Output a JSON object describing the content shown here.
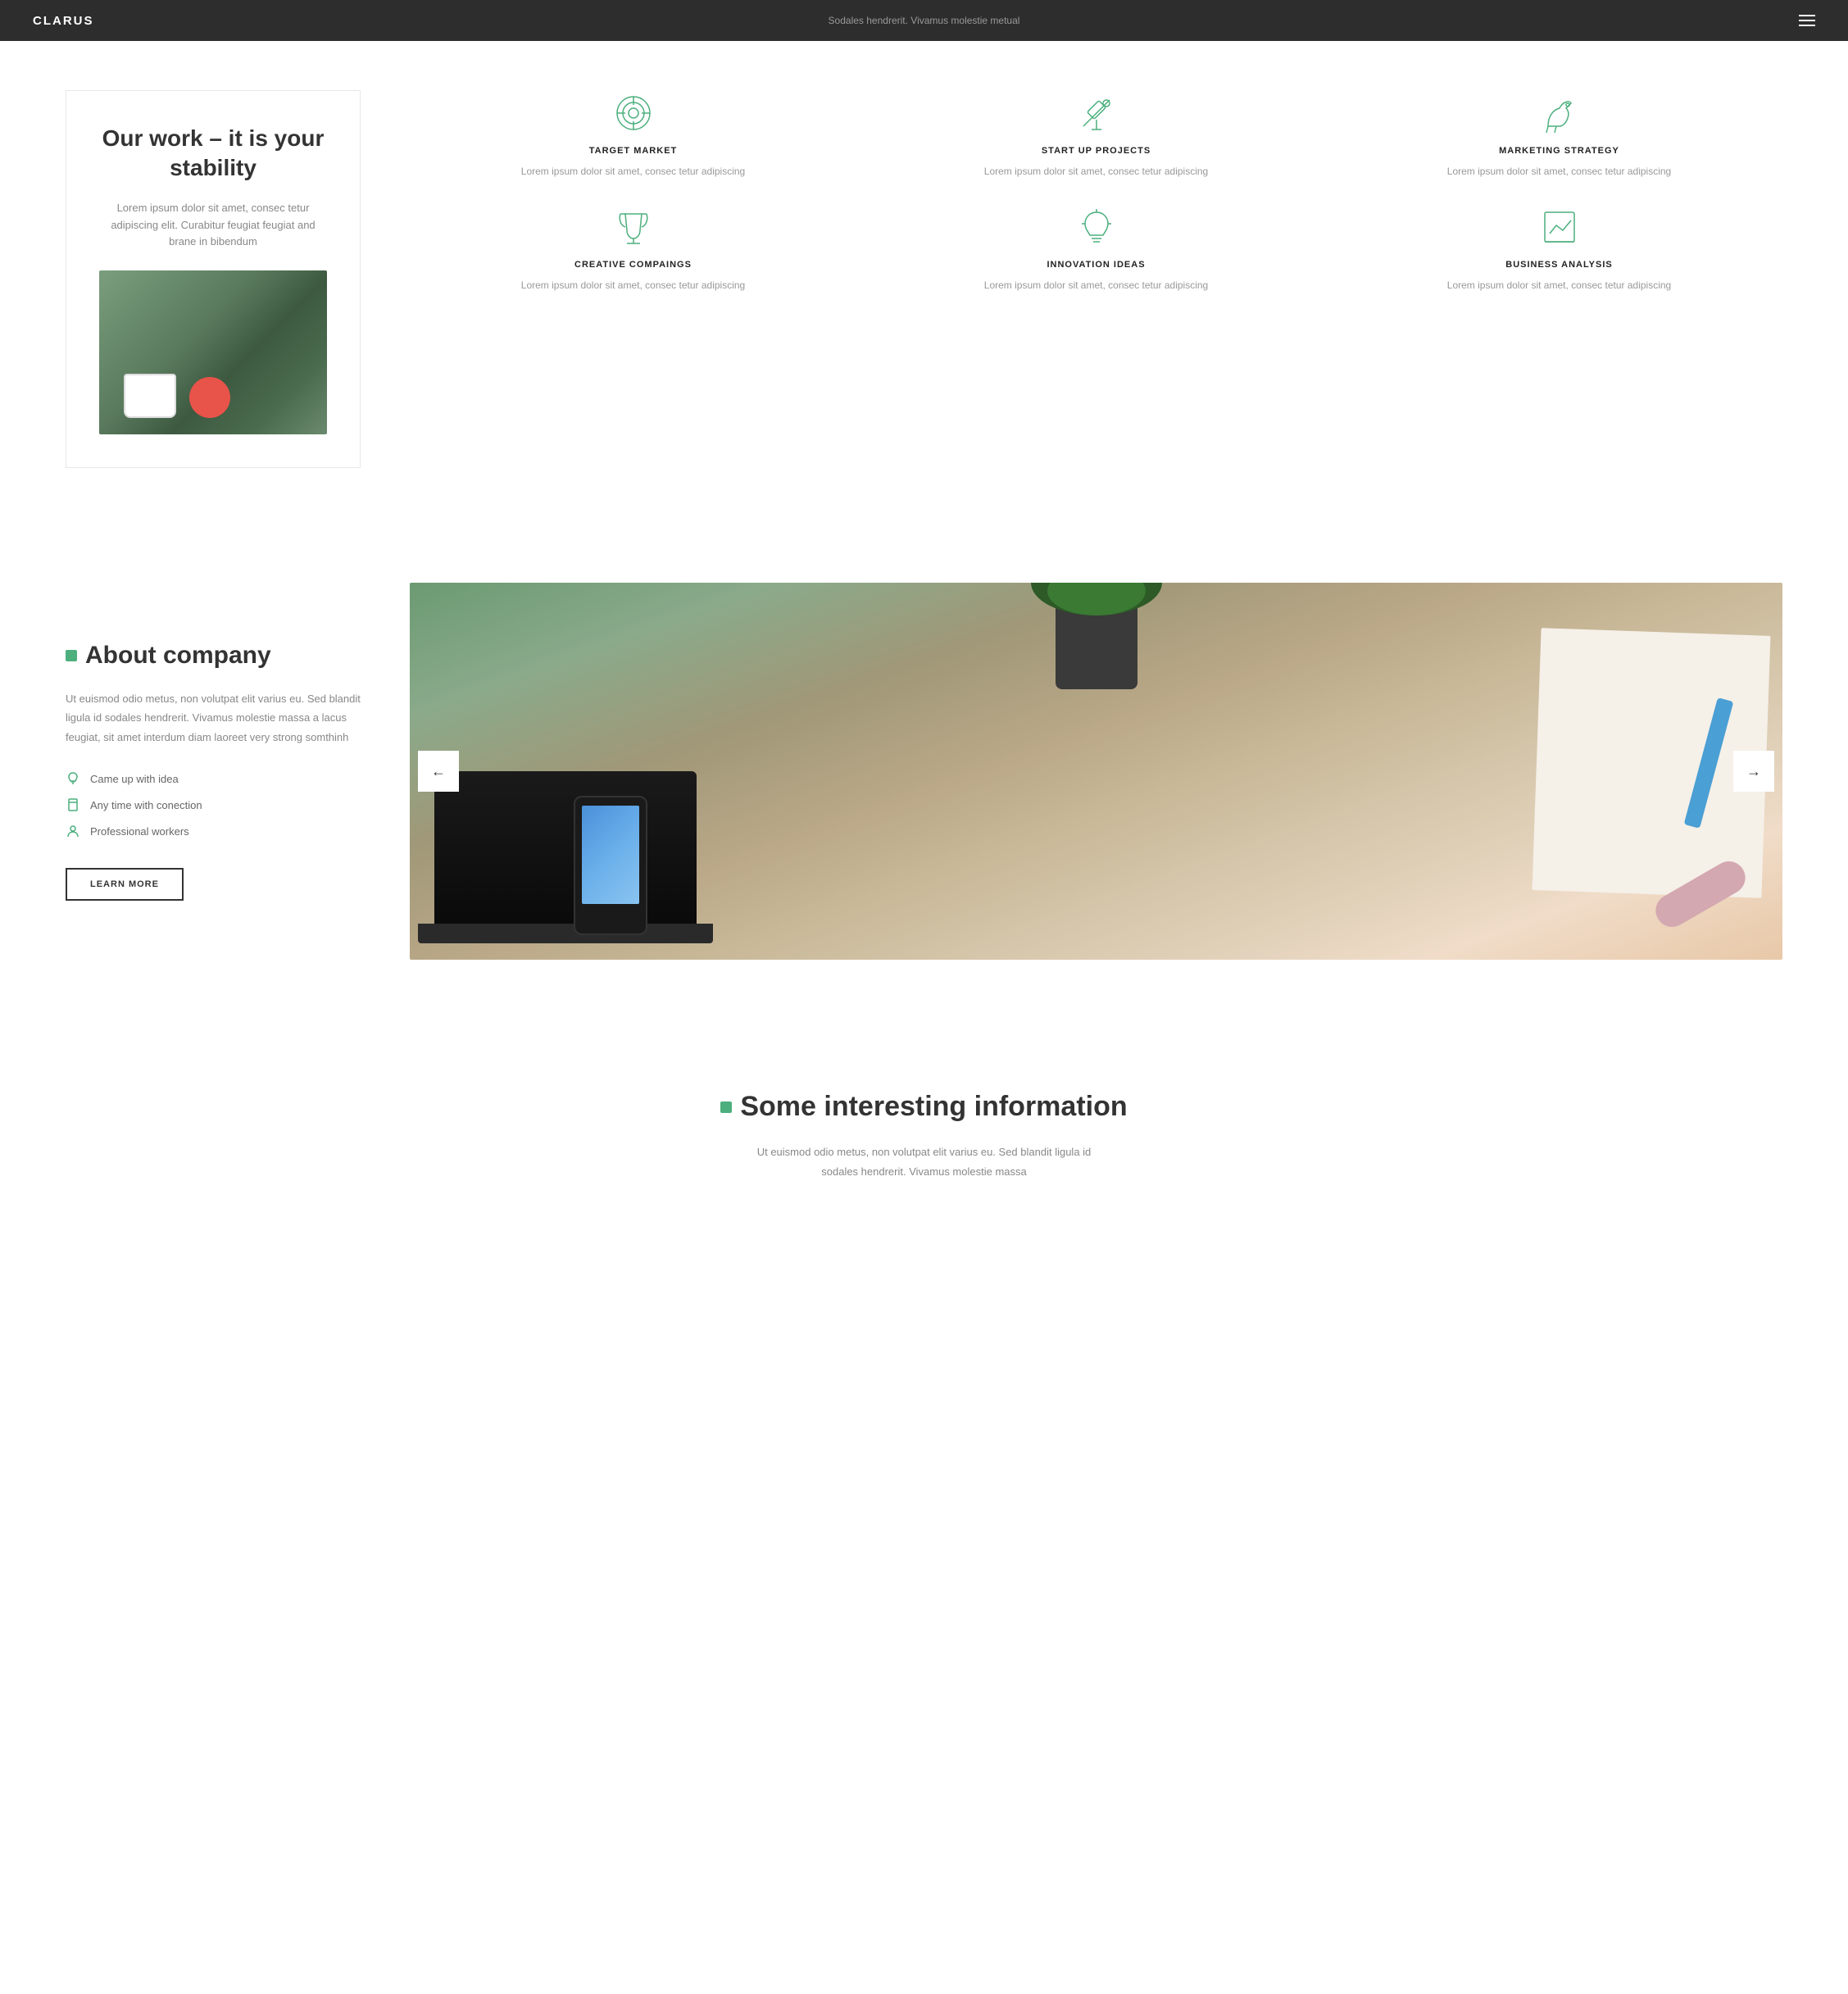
{
  "navbar": {
    "brand": "CLARUS",
    "tagline": "Sodales hendrerit. Vivamus molestie metual",
    "menu_icon": "hamburger-icon"
  },
  "section_work": {
    "title": "Our work – it is your stability",
    "description": "Lorem ipsum dolor sit amet, consec tetur adipiscing elit. Curabitur feugiat feugiat and brane in bibendum",
    "features": [
      {
        "id": "target-market",
        "title": "TARGET MARKET",
        "description": "Lorem ipsum dolor sit amet, consec tetur adipiscing",
        "icon": "target"
      },
      {
        "id": "startup-projects",
        "title": "START UP PROJECTS",
        "description": "Lorem ipsum dolor sit amet, consec tetur adipiscing",
        "icon": "telescope"
      },
      {
        "id": "marketing-strategy",
        "title": "MARKETING STRATEGY",
        "description": "Lorem ipsum dolor sit amet, consec tetur adipiscing",
        "icon": "horse"
      },
      {
        "id": "creative-campaigns",
        "title": "CREATIVE COMPAINGS",
        "description": "Lorem ipsum dolor sit amet, consec tetur adipiscing",
        "icon": "trophy"
      },
      {
        "id": "innovation-ideas",
        "title": "INNOVATION IDEAS",
        "description": "Lorem ipsum dolor sit amet, consec tetur adipiscing",
        "icon": "lightbulb"
      },
      {
        "id": "business-analysis",
        "title": "BUSINESS ANALYSIS",
        "description": "Lorem ipsum dolor sit amet, consec tetur adipiscing",
        "icon": "chart"
      }
    ]
  },
  "section_about": {
    "heading": "About company",
    "body": "Ut euismod odio metus, non volutpat elit varius eu. Sed blandit ligula id sodales hendrerit. Vivamus molestie massa a lacus feugiat, sit amet interdum diam laoreet very strong somthinh",
    "list_items": [
      {
        "text": "Came up with idea",
        "icon": "lightbulb"
      },
      {
        "text": "Any time with conection",
        "icon": "bookmark"
      },
      {
        "text": "Professional workers",
        "icon": "person"
      }
    ],
    "button_label": "LEARN MORE",
    "prev_label": "←",
    "next_label": "→"
  },
  "section_info": {
    "heading": "Some interesting information",
    "body": "Ut euismod odio metus, non volutpat elit varius eu. Sed blandit ligula id sodales hendrerit. Vivamus molestie massa"
  }
}
